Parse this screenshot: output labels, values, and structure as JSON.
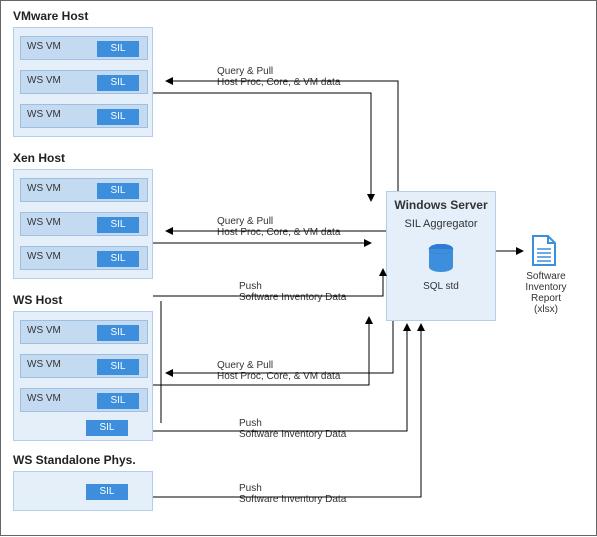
{
  "hosts": {
    "vmware": {
      "title": "VMware Host",
      "vm_label": "WS VM",
      "sil": "SIL"
    },
    "xen": {
      "title": "Xen Host",
      "vm_label": "WS VM",
      "sil": "SIL"
    },
    "wshost": {
      "title": "WS Host",
      "vm_label": "WS VM",
      "sil": "SIL"
    },
    "standalone": {
      "title": "WS Standalone Phys.",
      "sil": "SIL"
    }
  },
  "server": {
    "title": "Windows Server",
    "subtitle": "SIL Aggregator",
    "db_label": "SQL std"
  },
  "report": {
    "line1": "Software",
    "line2": "Inventory Report",
    "line3": "(xlsx)"
  },
  "edges": {
    "query_pull": {
      "title": "Query & Pull",
      "sub": "Host Proc, Core, & VM data"
    },
    "push_inv": {
      "title": "Push",
      "sub": "Software Inventory Data"
    }
  }
}
